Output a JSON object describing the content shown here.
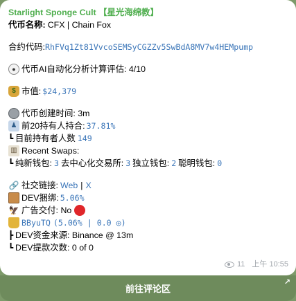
{
  "message": {
    "title": "Starlight Sponge Cult 【星光海绵教】",
    "token_name_label": "代币名称:",
    "token_name_value": "CFX | Chain Fox",
    "contract_label": "合约代码:",
    "contract_value": "RhFVq1Zt81VvcoSEMSyCGZZv5SwBdA8MV7w4HEMpump",
    "ai_score_label": "代币AI自动化分析计算评估: 4/10",
    "market_cap_label": "市值:",
    "market_cap_value": "$24,379",
    "created_label": "代币创建时间: 3m",
    "top20_label": "前20持有人持合:",
    "top20_value": "37.81%",
    "holders_label": "目前持有者人数",
    "holders_value": "149",
    "swaps_label": "Recent Swaps:",
    "swaps_pure_label": "纯新钱包:",
    "swaps_pure_value": "3",
    "swaps_dex_label": "去中心化交易所:",
    "swaps_dex_value": "3",
    "swaps_indep_label": "独立钱包:",
    "swaps_indep_value": "2",
    "swaps_smart_label": "聪明钱包:",
    "swaps_smart_value": "0",
    "social_label": "社交链接:",
    "social_web": "Web",
    "social_sep": "|",
    "social_x": "X",
    "dev_bundle_label": "DEV捆绑:",
    "dev_bundle_value": "5.06%",
    "ad_label": "广告交付: No",
    "dev_wallet_name": "BByuTQ",
    "dev_wallet_stats": "(5.06% | 0.0 ◎)",
    "dev_source_label": "DEV资金来源: Binance @ 13m",
    "dev_withdraw_label": "DEV提款次数: 0 of 0",
    "views": "11",
    "time": "上午 10:55"
  },
  "comment_button": {
    "label": "前往评论区",
    "arrow": "↗"
  },
  "icons": {
    "eye": "eye-icon",
    "money_bag": "money-bag-icon",
    "globe": "globe-icon",
    "person": "person-icon",
    "bank": "bank-icon",
    "link": "link-icon",
    "package": "package-icon",
    "eagle": "eagle-icon",
    "trophy": "trophy-icon"
  },
  "colors": {
    "title": "#4fae4e",
    "link": "#3a75b8",
    "background": "#7d9a6a",
    "button": "#6e8b5c",
    "red_dot": "#e0262a"
  }
}
